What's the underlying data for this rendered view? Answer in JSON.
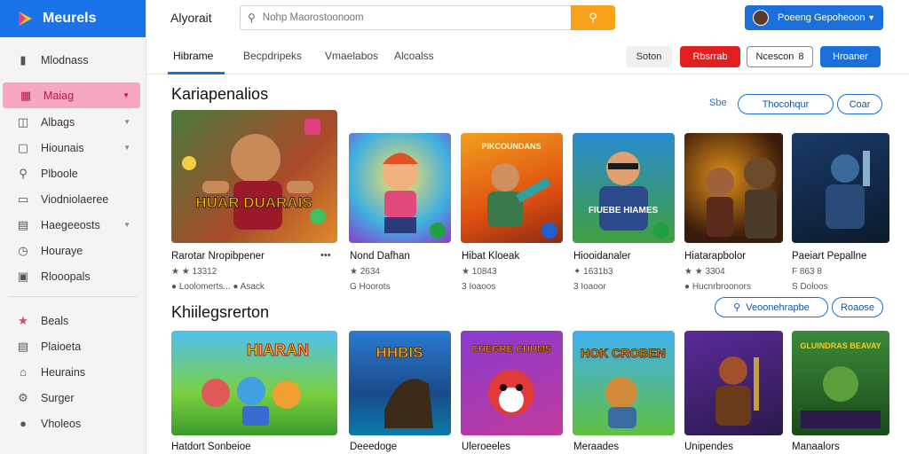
{
  "app": {
    "brand": "Meurels",
    "title": "Alyorait"
  },
  "search": {
    "placeholder": "Nohp Maorostoonoom"
  },
  "account": {
    "name": "Poeeng Gepoheoon"
  },
  "sidebar": {
    "items": [
      {
        "label": "Mlodnass",
        "icon": "map-icon"
      },
      {
        "label": "Maiag",
        "icon": "grid-icon",
        "active": true,
        "chevron": true
      },
      {
        "label": "Albags",
        "icon": "layers-icon",
        "chevron": true
      },
      {
        "label": "Hiounais",
        "icon": "box-icon",
        "chevron": true
      },
      {
        "label": "Plboole",
        "icon": "pin-icon"
      },
      {
        "label": "Viodniolaeree",
        "icon": "message-icon"
      },
      {
        "label": "Haegeeosts",
        "icon": "folder-icon",
        "chevron": true
      },
      {
        "label": "Houraye",
        "icon": "clock-icon"
      },
      {
        "label": "Rlooopals",
        "icon": "bag-icon"
      },
      {
        "label": "Beals",
        "icon": "star-icon"
      },
      {
        "label": "Plaioeta",
        "icon": "tray-icon"
      },
      {
        "label": "Heurains",
        "icon": "tag-icon"
      },
      {
        "label": "Surger",
        "icon": "gear-icon"
      },
      {
        "label": "Vholeos",
        "icon": "info-icon"
      }
    ]
  },
  "tabs": [
    "Hibrame",
    "Becpdripeks",
    "Vmaelabos",
    "Alcoalss"
  ],
  "toolbar": {
    "btn_plain": "Soton",
    "btn_red": "Rbsrrab",
    "btn_outline": "Ncescon",
    "btn_outline_count": "8",
    "btn_blue": "Hroaner"
  },
  "section1": {
    "title": "Kariapenalios",
    "link": "Sbe",
    "pill_a": "Thocohqur",
    "pill_b": "Coar",
    "cards": [
      {
        "title": "Rarotar Nropibpener",
        "meta1": "★ ★ 13312",
        "meta2": "● Loolomerts... ● Asack",
        "more": "•••"
      },
      {
        "title": "Nond Dafhan",
        "meta1": "★ 2634",
        "meta2": "G Hoorots"
      },
      {
        "title": "Hibat Kloeak",
        "meta1": "★ 10843",
        "meta2": "3 Ioaoos"
      },
      {
        "title": "Hiooidanaler",
        "meta1": "✦ 1631b3",
        "meta2": "3 Ioaoor"
      },
      {
        "title": "Hiatarapbolor",
        "meta1": "★ ★ 3304",
        "meta2": "● Hucnrbroonors"
      },
      {
        "title": "Paeiart Pepallne",
        "meta1": "F 863 8",
        "meta2": "S Doloos"
      }
    ]
  },
  "section2": {
    "title": "Khiilegsrerton",
    "pill_a": "Veoonehrapbe",
    "pill_b": "Roaose",
    "cards": [
      {
        "title": "Hatdort Sonbeioe"
      },
      {
        "title": "Deeedoge"
      },
      {
        "title": "Uleroeeles"
      },
      {
        "title": "Meraades"
      },
      {
        "title": "Unipendes"
      },
      {
        "title": "Manaalors"
      }
    ]
  },
  "art": {
    "s1": [
      "HUAR DUARAIS",
      "",
      "PIKCOUNDANS",
      "FIUEBE HIAMES",
      "",
      ""
    ],
    "s2": [
      "HIARAN",
      "HHBIS",
      "CHEGRE CHUMS",
      "HOK CROBEN",
      "",
      "GLUINDRAS BEAVAY"
    ]
  },
  "colors": {
    "brand": "#1a73e8",
    "accent": "#f7a21a",
    "active": "#f7a8c0",
    "danger": "#e02020"
  }
}
